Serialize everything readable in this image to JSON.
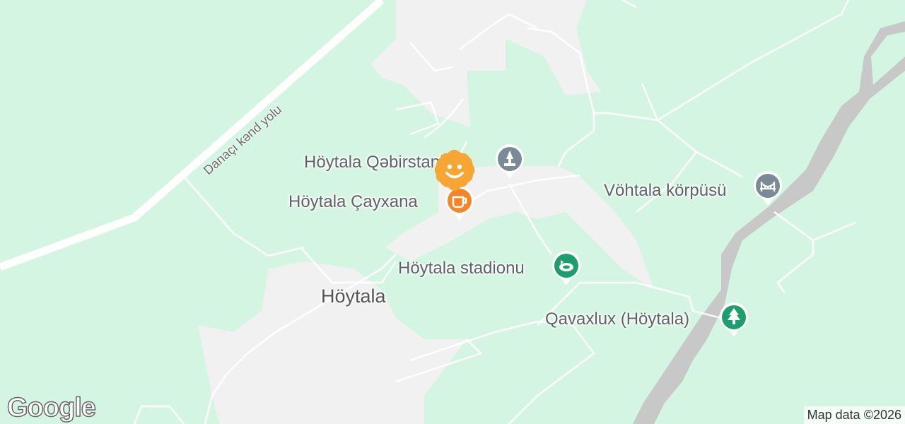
{
  "road_label": "Danaçı kənd yolu",
  "town_label": "Höytala",
  "pois": [
    {
      "id": "cemetery",
      "name": "Höytala Qəbirstanlığı",
      "icon": "cemetery-icon",
      "color": "#7a8a96"
    },
    {
      "id": "teahouse",
      "name": "Höytala Çayxana",
      "icon": "cafe-icon",
      "color": "#f4862a"
    },
    {
      "id": "bridge",
      "name": "Vöhtala körpüsü",
      "icon": "bridge-icon",
      "color": "#7a8a96"
    },
    {
      "id": "stadium",
      "name": "Höytala stadionu",
      "icon": "stadium-icon",
      "color": "#1e9e6e"
    },
    {
      "id": "forest",
      "name": "Qavaxlux (Höytala)",
      "icon": "forest-icon",
      "color": "#1e9e6e"
    }
  ],
  "location_marker": {
    "icon": "smiley-icon",
    "color": "#f7a533"
  },
  "attribution": "Map data ©2026",
  "logo": "Google"
}
